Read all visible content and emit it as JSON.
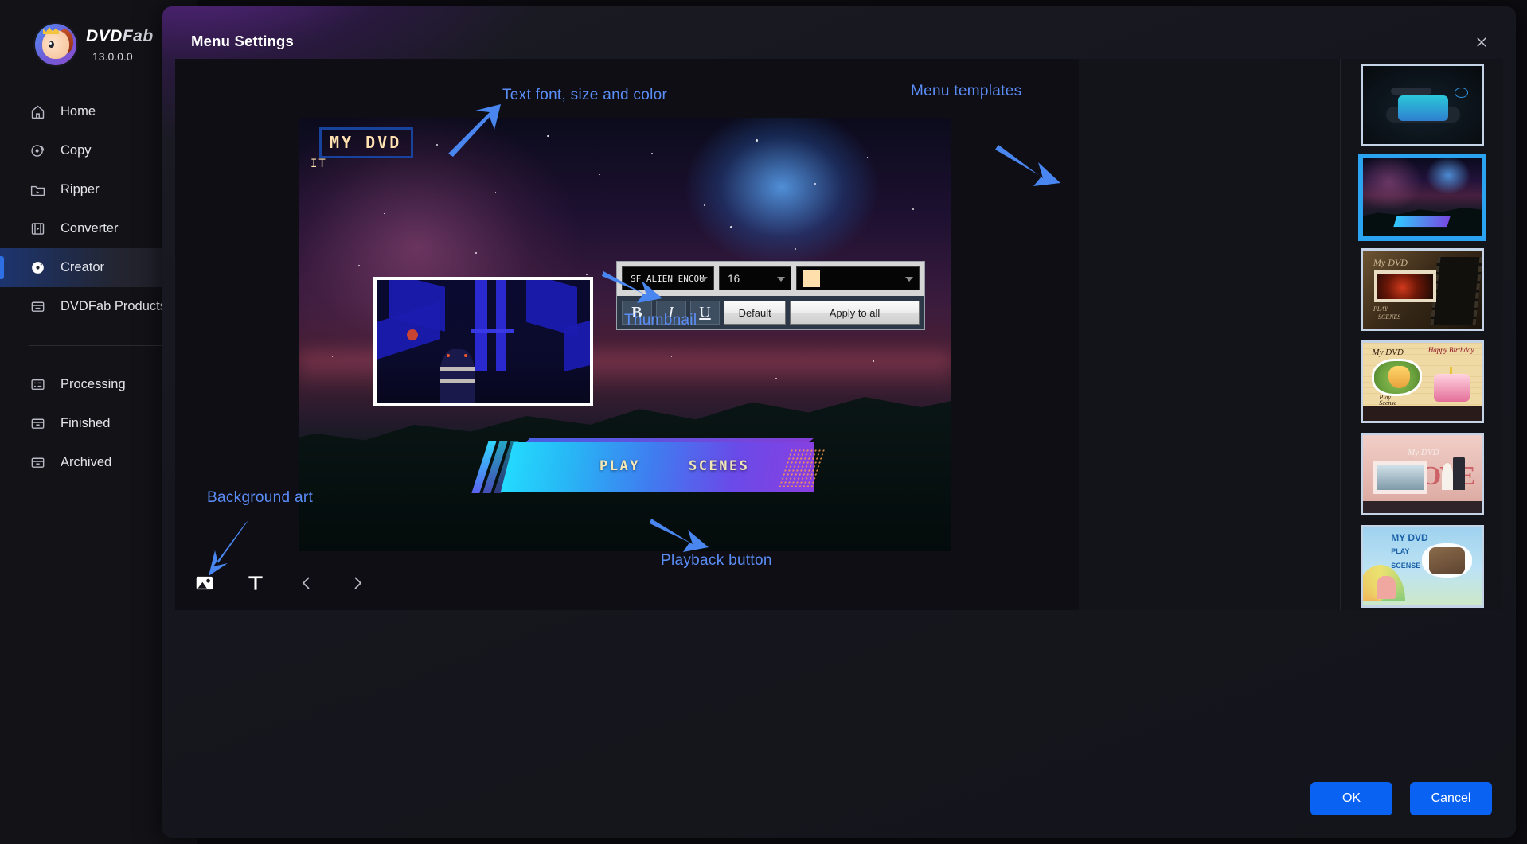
{
  "sidebar": {
    "brand": {
      "name_bold": "DVD",
      "name_light": "Fab",
      "version": "13.0.0.0"
    },
    "items": [
      {
        "label": "Home",
        "icon": "home-icon"
      },
      {
        "label": "Copy",
        "icon": "copy-disc-icon"
      },
      {
        "label": "Ripper",
        "icon": "ripper-folder-icon"
      },
      {
        "label": "Converter",
        "icon": "converter-film-icon"
      },
      {
        "label": "Creator",
        "icon": "creator-disc-icon"
      },
      {
        "label": "DVDFab Products",
        "icon": "products-box-icon"
      }
    ],
    "secondary_items": [
      {
        "label": "Processing",
        "icon": "processing-list-icon"
      },
      {
        "label": "Finished",
        "icon": "finished-box-icon"
      },
      {
        "label": "Archived",
        "icon": "archived-box-icon"
      }
    ],
    "active_item": "Creator"
  },
  "dialog": {
    "title": "Menu Settings",
    "close_icon": "close-icon"
  },
  "preview": {
    "dvd_title": "MY DVD",
    "sub_title": "IT",
    "playback": {
      "play_label": "PLAY",
      "scenes_label": "SCENES"
    }
  },
  "font_toolbar": {
    "font_family_value": "SF ALIEN ENCOU",
    "font_size_value": "16",
    "color_value": "#ffe0ad",
    "bold_label": "B",
    "italic_label": "I",
    "underline_label": "U",
    "default_label": "Default",
    "apply_all_label": "Apply to all"
  },
  "annotations": [
    {
      "text": "Text font, size and color"
    },
    {
      "text": "Menu templates"
    },
    {
      "text": "Thumbnail"
    },
    {
      "text": "Background art"
    },
    {
      "text": "Playback button"
    }
  ],
  "bottom_tools": [
    {
      "icon": "image-icon",
      "name": "background-image-tool"
    },
    {
      "icon": "text-icon",
      "name": "add-text-tool"
    },
    {
      "icon": "chevron-left-icon",
      "name": "previous-page-tool"
    },
    {
      "icon": "chevron-right-icon",
      "name": "next-page-tool"
    }
  ],
  "templates": [
    {
      "name": "dark-tech-template",
      "selected": false
    },
    {
      "name": "space-mountain-template",
      "selected": true
    },
    {
      "name": "film-reel-template",
      "selected": false,
      "title": "My DVD",
      "play": "PLAY",
      "scenes": "SCENES"
    },
    {
      "name": "birthday-template",
      "selected": false,
      "title": "My DVD",
      "happy": "Happy Birthday",
      "play": "Play",
      "scenes": "Scense"
    },
    {
      "name": "wedding-template",
      "selected": false,
      "title": "My DVD",
      "love": "LOVE"
    },
    {
      "name": "kids-template",
      "selected": false,
      "title": "MY DVD",
      "play": "PLAY",
      "scenes": "SCENSE"
    }
  ],
  "footer": {
    "ok_label": "OK",
    "cancel_label": "Cancel"
  },
  "colors": {
    "accent": "#0a62f2",
    "annotation": "#5b8df7",
    "selected_border": "#2aa3f0"
  }
}
